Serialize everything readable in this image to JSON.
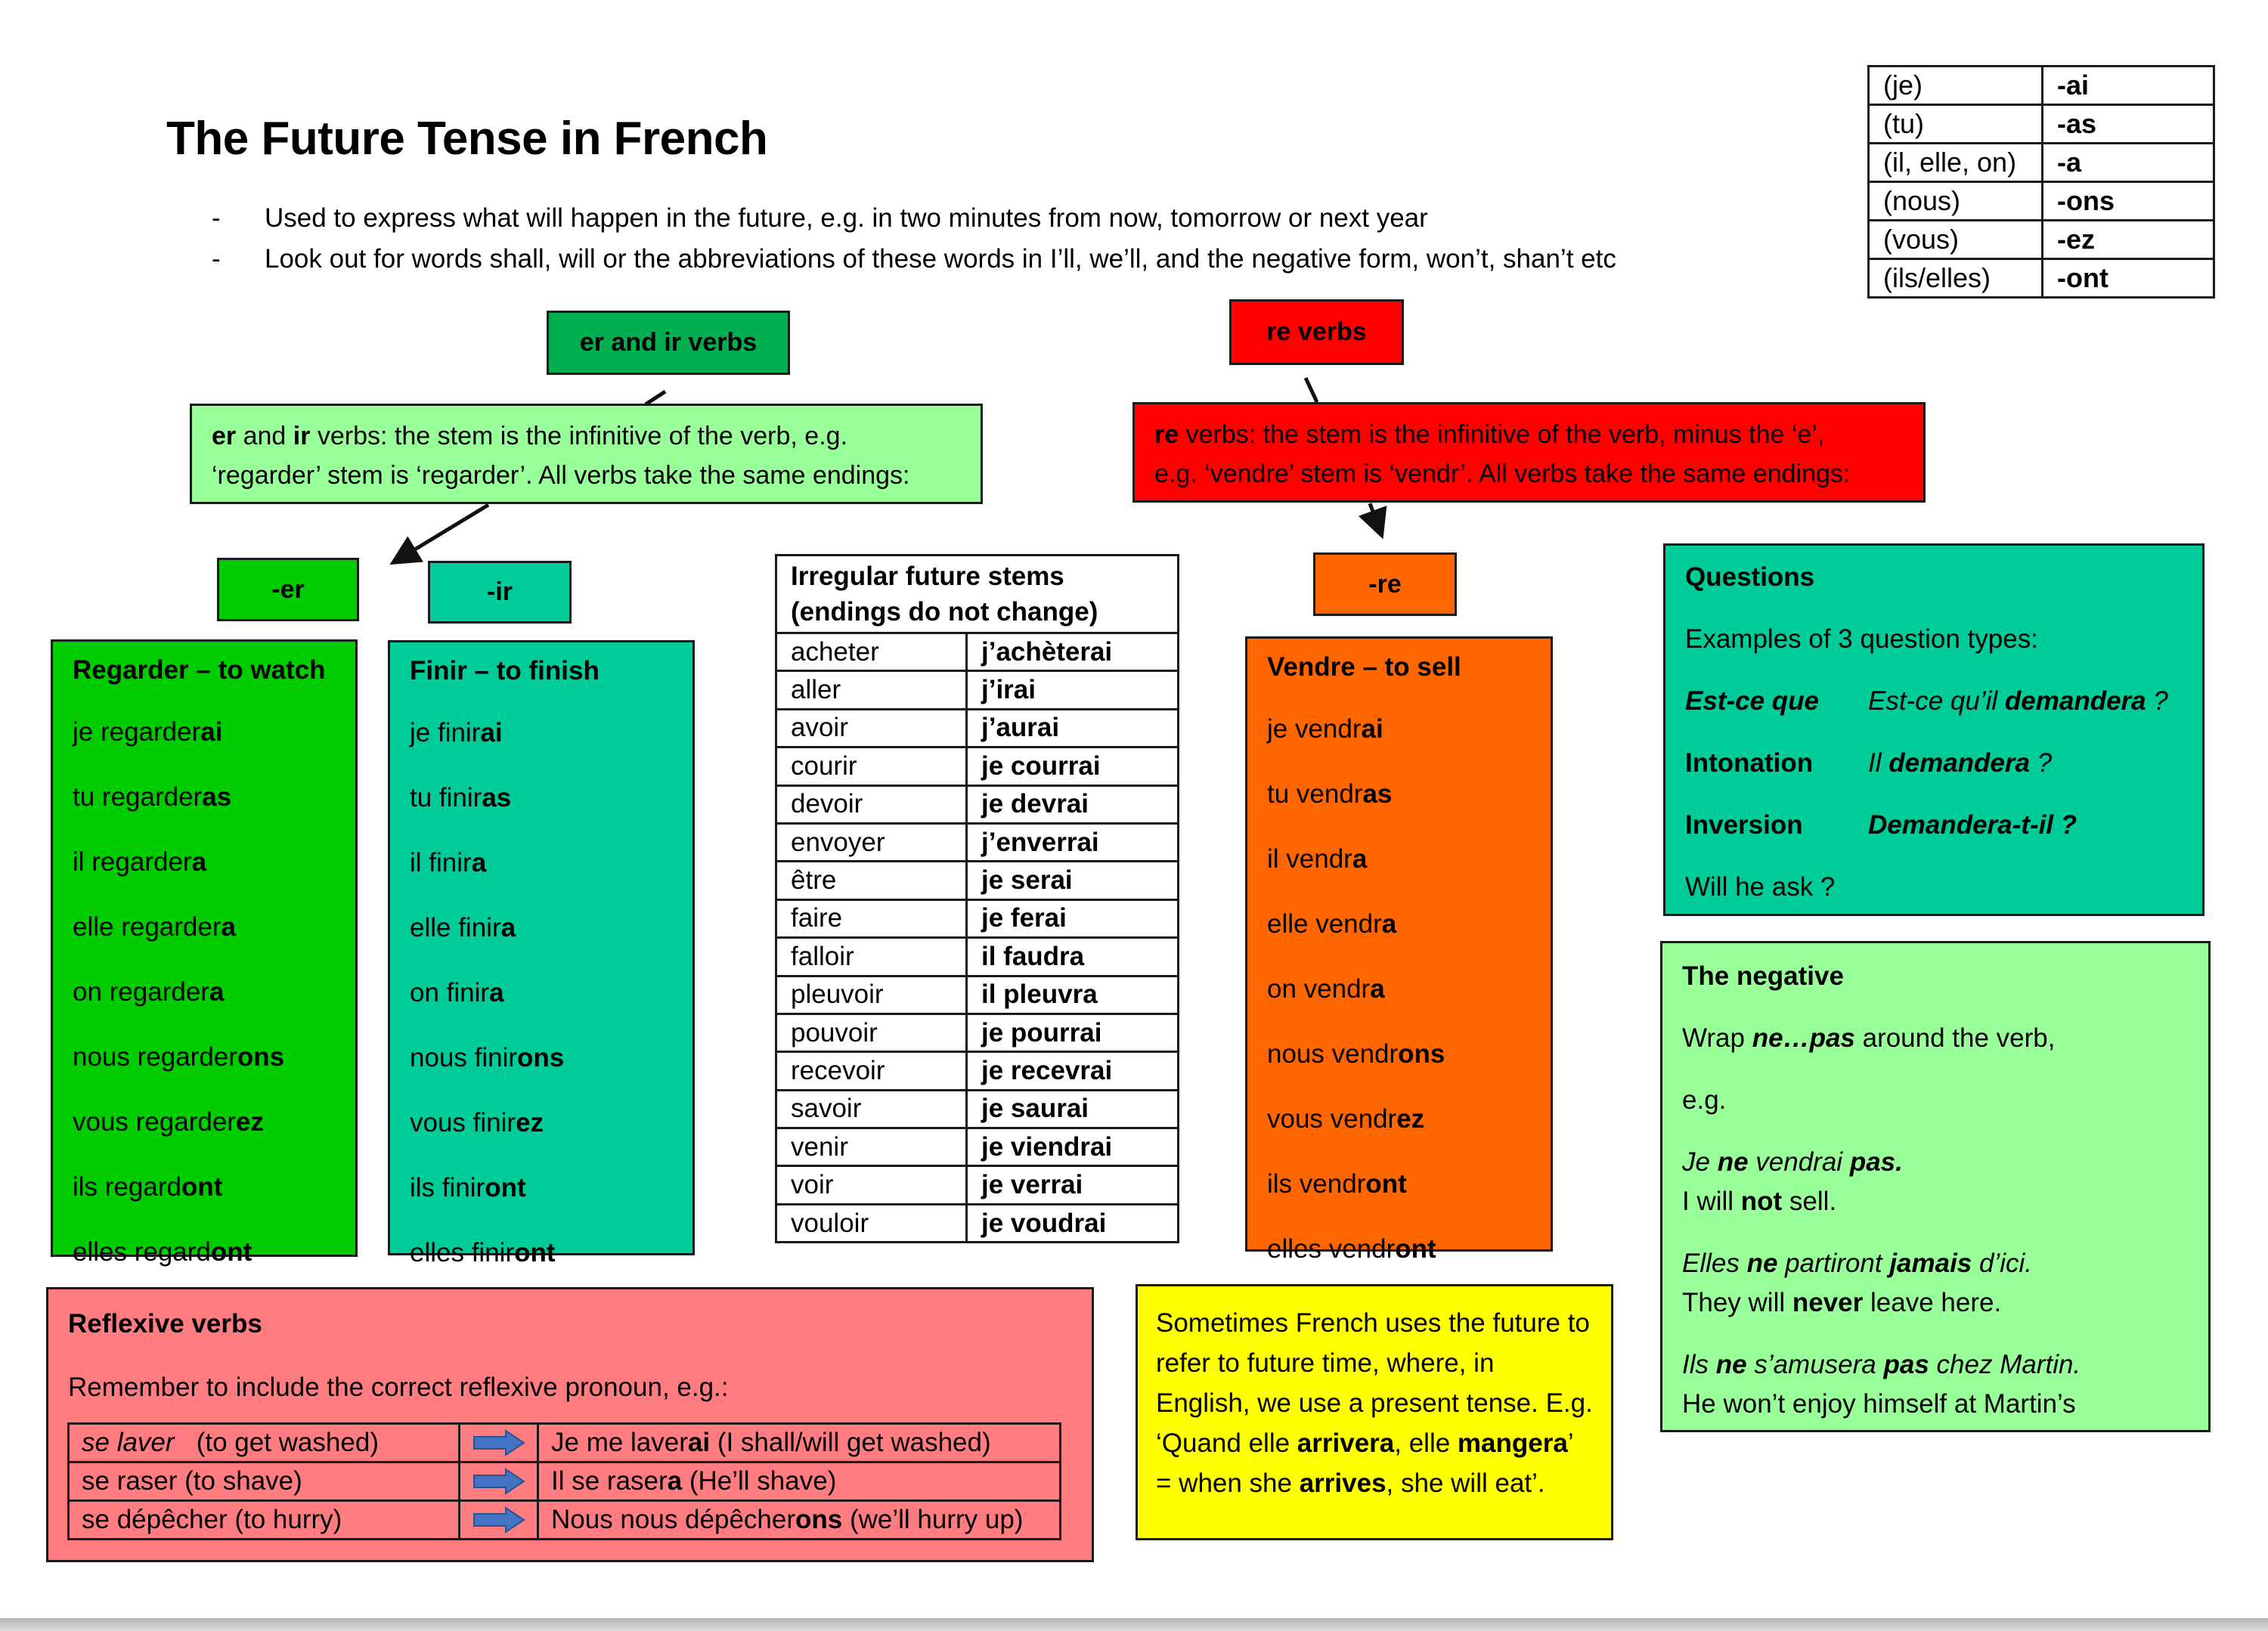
{
  "title": "The Future Tense in French",
  "bullets": [
    {
      "dash": "-",
      "text": "Used to express what will happen in the future, e.g. in two minutes from  now, tomorrow or next year"
    },
    {
      "dash": "-",
      "text": "Look out for words shall, will or the abbreviations of these words in I’ll, we’ll, and the negative form, won’t, shan’t etc"
    }
  ],
  "endings_table": [
    {
      "pronoun": "(je)",
      "ending": "-ai"
    },
    {
      "pronoun": "(tu)",
      "ending": "-as"
    },
    {
      "pronoun": "(il, elle, on)",
      "ending": "-a"
    },
    {
      "pronoun": "(nous)",
      "ending": "-ons"
    },
    {
      "pronoun": "(vous)",
      "ending": "-ez"
    },
    {
      "pronoun": "(ils/elles)",
      "ending": "-ont"
    }
  ],
  "labels": {
    "er_ir_verbs": "er and ir verbs",
    "re_verbs": "re verbs",
    "er": "-er",
    "ir": "-ir",
    "re": "-re"
  },
  "explainers": {
    "er_ir": {
      "bold_er": "er",
      "and": " and ",
      "bold_ir": "ir",
      "rest_line1": " verbs: the stem is the infinitive of the verb, e.g.",
      "line2": "‘regarder’ stem is ‘regarder’. All verbs take the same endings:"
    },
    "re": {
      "bold_re": "re",
      "rest_line1": " verbs: the stem is the infinitive of the verb, minus the ‘e’,",
      "line2": "e.g. ‘vendre’ stem is ‘vendr’. All verbs take the same endings:"
    }
  },
  "conjugations": {
    "regarder": {
      "title": "Regarder – to watch",
      "rows": [
        {
          "stem": "je regarder",
          "ending": "ai"
        },
        {
          "stem": "tu regarder",
          "ending": "as"
        },
        {
          "stem": "il regarder",
          "ending": "a"
        },
        {
          "stem": "elle regarder",
          "ending": "a"
        },
        {
          "stem": "on regarder",
          "ending": "a"
        },
        {
          "stem": "nous regarder",
          "ending": "ons"
        },
        {
          "stem": "vous regarder",
          "ending": "ez"
        },
        {
          "stem": "ils regard",
          "ending": "ont"
        },
        {
          "stem": "elles regard",
          "ending": "ont"
        }
      ]
    },
    "finir": {
      "title": "Finir – to finish",
      "rows": [
        {
          "stem": "je finir",
          "ending": "ai"
        },
        {
          "stem": "tu finir",
          "ending": "as"
        },
        {
          "stem": "il finir",
          "ending": "a"
        },
        {
          "stem": "elle finir",
          "ending": "a"
        },
        {
          "stem": "on finir",
          "ending": "a"
        },
        {
          "stem": "nous finir",
          "ending": "ons"
        },
        {
          "stem": "vous finir",
          "ending": "ez"
        },
        {
          "stem": "ils finir",
          "ending": "ont"
        },
        {
          "stem": "elles finir",
          "ending": "ont"
        }
      ]
    },
    "vendre": {
      "title": "Vendre – to sell",
      "rows": [
        {
          "stem": "je vendr",
          "ending": "ai"
        },
        {
          "stem": "tu vendr",
          "ending": "as"
        },
        {
          "stem": "il vendr",
          "ending": "a"
        },
        {
          "stem": "elle vendr",
          "ending": "a"
        },
        {
          "stem": "on vendr",
          "ending": "a"
        },
        {
          "stem": "nous vendr",
          "ending": "ons"
        },
        {
          "stem": "vous vendr",
          "ending": "ez"
        },
        {
          "stem": "ils vendr",
          "ending": "ont"
        },
        {
          "stem": "elles vendr",
          "ending": "ont"
        }
      ]
    }
  },
  "irregular": {
    "header_line1": "Irregular future stems",
    "header_line2": "(endings do not change)",
    "rows": [
      {
        "infinitive": "acheter",
        "future": "j’achèterai"
      },
      {
        "infinitive": "aller",
        "future": "j’irai"
      },
      {
        "infinitive": "avoir",
        "future": "j’aurai"
      },
      {
        "infinitive": "courir",
        "future": "je courrai"
      },
      {
        "infinitive": "devoir",
        "future": "je devrai"
      },
      {
        "infinitive": "envoyer",
        "future": "j’enverrai"
      },
      {
        "infinitive": "être",
        "future": "je serai"
      },
      {
        "infinitive": "faire",
        "future": "je ferai"
      },
      {
        "infinitive": "falloir",
        "future": "il faudra"
      },
      {
        "infinitive": "pleuvoir",
        "future": "il pleuvra"
      },
      {
        "infinitive": "pouvoir",
        "future": "je pourrai"
      },
      {
        "infinitive": "recevoir",
        "future": "je recevrai"
      },
      {
        "infinitive": "savoir",
        "future": "je saurai"
      },
      {
        "infinitive": "venir",
        "future": "je viendrai"
      },
      {
        "infinitive": "voir",
        "future": "je verrai"
      },
      {
        "infinitive": "vouloir",
        "future": "je voudrai"
      }
    ]
  },
  "questions": {
    "title": "Questions",
    "intro": "Examples of 3 question types:",
    "types": [
      {
        "type": "Est-ce que",
        "example_plain": "Est-ce qu’il ",
        "example_bold": "demandera",
        "example_end": " ?"
      },
      {
        "type": "Intonation",
        "example_plain": "Il ",
        "example_bold": "demandera",
        "example_end": " ?"
      },
      {
        "type": "Inversion",
        "example_plain": "",
        "example_bold": "Demandera-t-il ?",
        "example_end": ""
      }
    ],
    "translation": "Will he ask ?"
  },
  "negative": {
    "title": "The negative",
    "wrap_pre": "Wrap ",
    "wrap_bold": "ne…pas",
    "wrap_post": " around the verb,",
    "eg": "e.g.",
    "examples": [
      {
        "fr_parts": [
          {
            "t": "Je ",
            "b": false
          },
          {
            "t": "ne",
            "b": true
          },
          {
            "t": " vendrai ",
            "b": false
          },
          {
            "t": "pas.",
            "b": true
          }
        ],
        "en_parts": [
          {
            "t": "I will ",
            "b": false
          },
          {
            "t": "not",
            "b": true
          },
          {
            "t": " sell.",
            "b": false
          }
        ]
      },
      {
        "fr_parts": [
          {
            "t": "Elles ",
            "b": false
          },
          {
            "t": "ne",
            "b": true
          },
          {
            "t": " partiront ",
            "b": false
          },
          {
            "t": "jamais",
            "b": true
          },
          {
            "t": " d’ici.",
            "b": false
          }
        ],
        "en_parts": [
          {
            "t": "They will ",
            "b": false
          },
          {
            "t": "never",
            "b": true
          },
          {
            "t": " leave here.",
            "b": false
          }
        ]
      },
      {
        "fr_parts": [
          {
            "t": "Ils ",
            "b": false
          },
          {
            "t": "ne",
            "b": true
          },
          {
            "t": " s’amusera ",
            "b": false
          },
          {
            "t": "pas",
            "b": true
          },
          {
            "t": " chez Martin.",
            "b": false
          }
        ],
        "en_parts": [
          {
            "t": "He won’t enjoy himself at Martin’s",
            "b": false
          }
        ]
      }
    ]
  },
  "reflexive": {
    "title": "Reflexive verbs",
    "intro": "Remember to include the correct reflexive pronoun, e.g.:",
    "rows": [
      {
        "verb_italic": "se laver",
        "verb_rest": "   (to get washed)",
        "arrow_icon": "right-arrow",
        "result_pre": "Je me laver",
        "result_bold": "ai",
        "result_post": " (I shall/will get washed)"
      },
      {
        "verb_italic": "",
        "verb_rest": "se raser (to shave)",
        "arrow_icon": "right-arrow",
        "result_pre": "Il se raser",
        "result_bold": "a",
        "result_post": " (He’ll shave)"
      },
      {
        "verb_italic": "",
        "verb_rest": "se dépêcher (to hurry)",
        "arrow_icon": "right-arrow",
        "result_pre": "Nous nous dépêcher",
        "result_bold": "ons",
        "result_post": " (we’ll hurry up)"
      }
    ]
  },
  "note": {
    "parts": [
      {
        "t": "Sometimes French uses the future to refer to future time, where, in English, we use a present tense. E.g. ‘Quand elle ",
        "b": false
      },
      {
        "t": "arrivera",
        "b": true
      },
      {
        "t": ", elle ",
        "b": false
      },
      {
        "t": "mangera",
        "b": true
      },
      {
        "t": "’ = when she ",
        "b": false
      },
      {
        "t": "arrives",
        "b": true
      },
      {
        "t": ", she will eat’.",
        "b": false
      }
    ]
  },
  "colors": {
    "er_ir_label": "#00b050",
    "re_label": "#ff0000",
    "er_column": "#00cc00",
    "ir_column": "#00cc99",
    "re_column": "#ff6600",
    "light_green": "#99ff99",
    "reflexive_pink": "#ff7c80",
    "note_yellow": "#ffff00",
    "arrow_blue": "#4472c4"
  }
}
